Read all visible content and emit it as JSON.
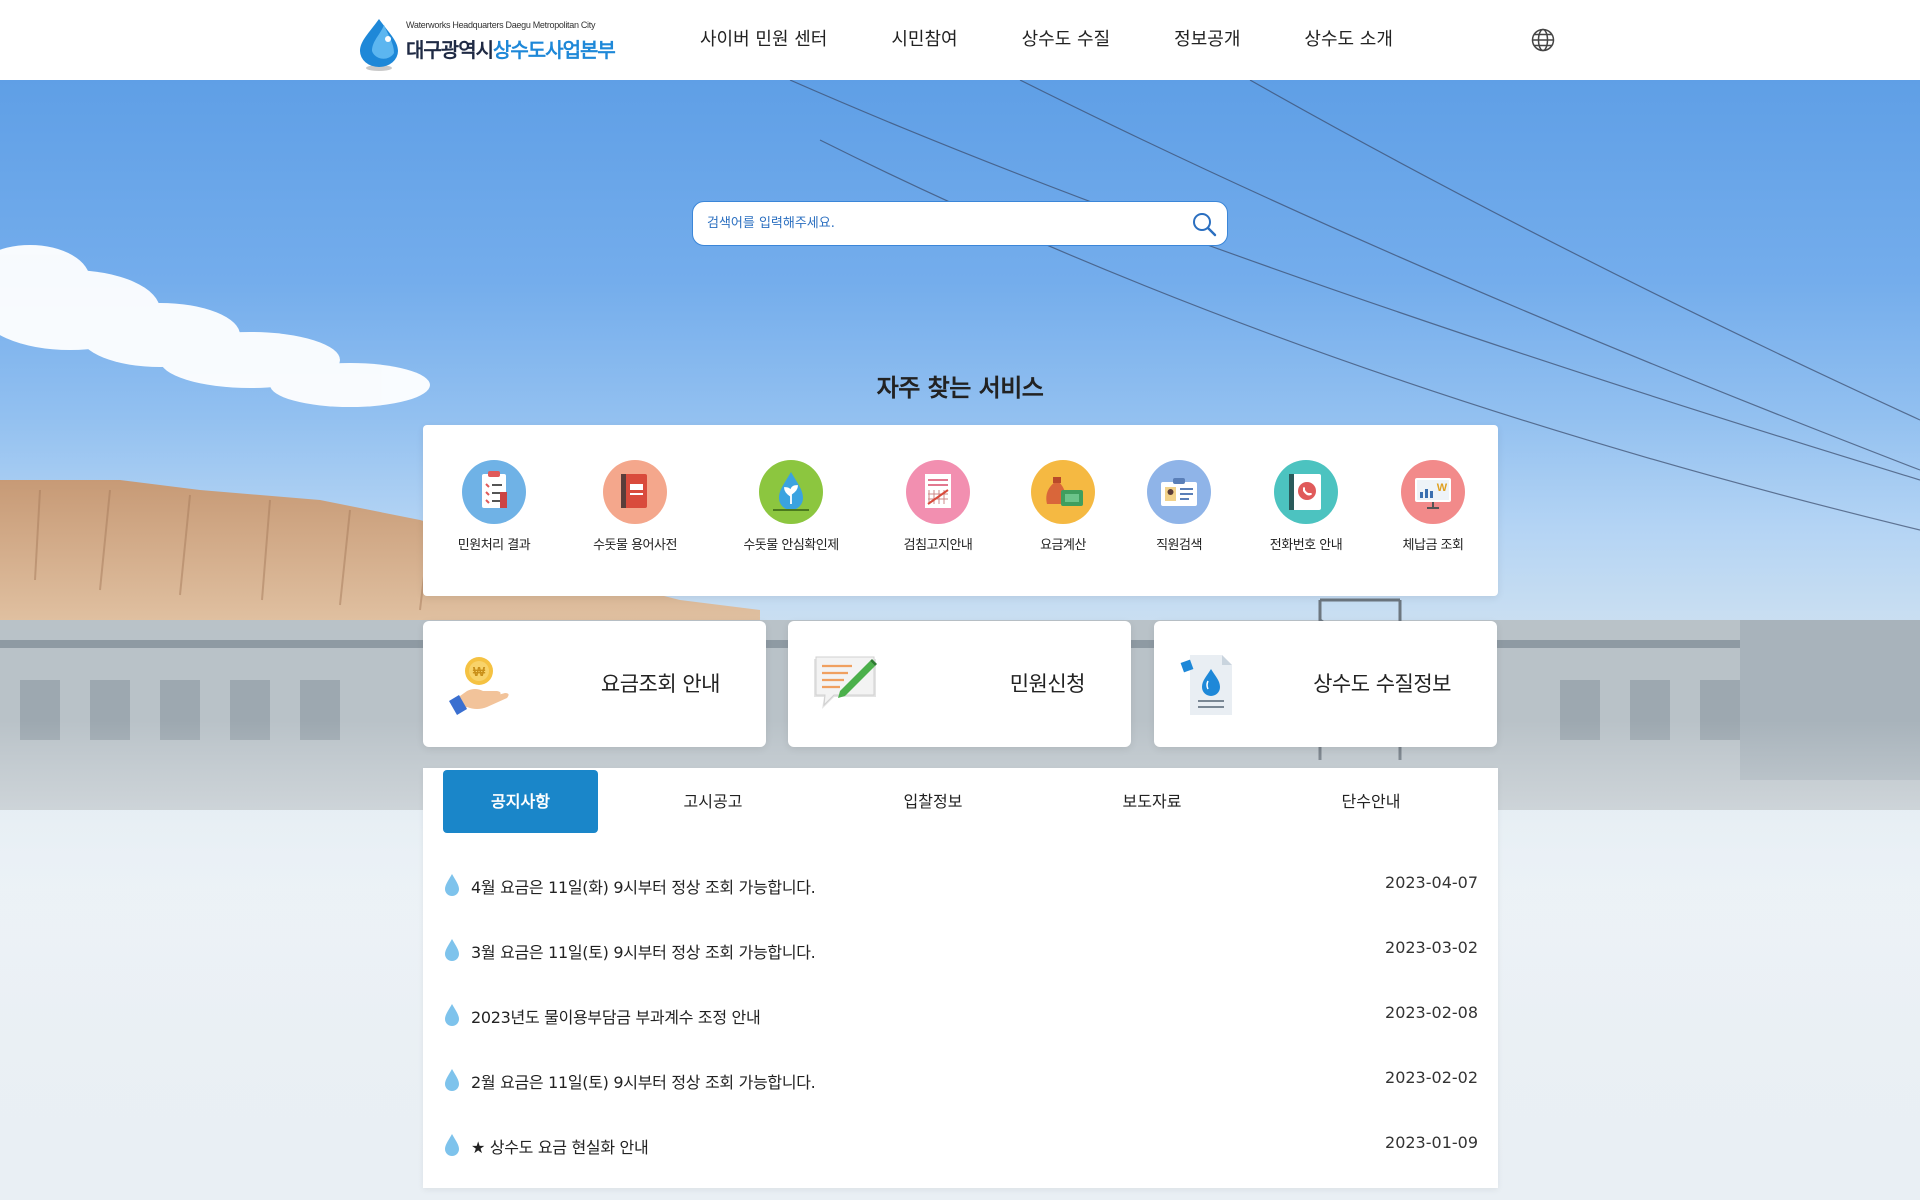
{
  "header": {
    "logo": {
      "subtitle": "Waterworks Headquarters Daegu Metropolitan City",
      "name_dark": "대구광역시",
      "name_blue": "상수도사업본부"
    },
    "nav": [
      "사이버 민원 센터",
      "시민참여",
      "상수도 수질",
      "정보공개",
      "상수도 소개"
    ],
    "globe_icon": "globe-icon"
  },
  "search": {
    "placeholder": "검색어를 입력해주세요.",
    "icon": "search-icon"
  },
  "quick": {
    "title": "자주 찾는 서비스",
    "items": [
      {
        "label": "민원처리 결과",
        "icon": "clipboard-icon",
        "color": "#6fb2e6"
      },
      {
        "label": "수돗물 용어사전",
        "icon": "book-icon",
        "color": "#f4a78c"
      },
      {
        "label": "수돗물 안심확인제",
        "icon": "water-drop-leaf-icon",
        "color": "#8cc63f"
      },
      {
        "label": "검침고지안내",
        "icon": "receipt-icon",
        "color": "#f28fb0"
      },
      {
        "label": "요금계산",
        "icon": "money-bag-icon",
        "color": "#f5b942"
      },
      {
        "label": "직원검색",
        "icon": "id-card-icon",
        "color": "#8fb4e8"
      },
      {
        "label": "전화번호 안내",
        "icon": "phone-book-icon",
        "color": "#4cc3c0"
      },
      {
        "label": "체납금 조회",
        "icon": "won-board-icon",
        "color": "#f28a8a"
      }
    ]
  },
  "cards": [
    {
      "label": "요금조회 안내",
      "icon": "coin-hand-icon"
    },
    {
      "label": "민원신청",
      "icon": "memo-pencil-icon"
    },
    {
      "label": "상수도 수질정보",
      "icon": "water-document-icon"
    }
  ],
  "board": {
    "tabs": [
      "공지사항",
      "고시공고",
      "입찰정보",
      "보도자료",
      "단수안내"
    ],
    "active_tab": "공지사항",
    "notices": [
      {
        "title": "4월 요금은 11일(화) 9시부터 정상 조회 가능합니다.",
        "date": "2023-04-07"
      },
      {
        "title": "3월 요금은 11일(토) 9시부터 정상 조회 가능합니다.",
        "date": "2023-03-02"
      },
      {
        "title": "2023년도 물이용부담금 부과계수 조정 안내",
        "date": "2023-02-08"
      },
      {
        "title": "2월 요금은 11일(토) 9시부터 정상 조회 가능합니다.",
        "date": "2023-02-02"
      },
      {
        "title": "★ 상수도 요금 현실화 안내",
        "date": "2023-01-09"
      }
    ]
  },
  "colors": {
    "brand_blue": "#1e88d8",
    "tab_active": "#1a86c9",
    "search_border": "#3b86d8"
  }
}
